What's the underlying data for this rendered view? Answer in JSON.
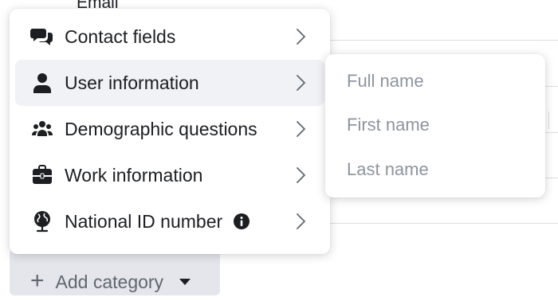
{
  "background": {
    "partial_label": "Email"
  },
  "menu": {
    "items": [
      {
        "label": "Contact fields",
        "icon": "chat-bubbles-icon"
      },
      {
        "label": "User information",
        "icon": "person-icon",
        "active": true
      },
      {
        "label": "Demographic questions",
        "icon": "group-icon"
      },
      {
        "label": "Work information",
        "icon": "briefcase-icon"
      },
      {
        "label": "National ID number",
        "icon": "globe-icon",
        "info_icon": "info-icon"
      }
    ]
  },
  "submenu": {
    "items": [
      {
        "label": "Full name"
      },
      {
        "label": "First name"
      },
      {
        "label": "Last name"
      }
    ]
  },
  "add_category": {
    "label": "Add category"
  },
  "colors": {
    "text": "#1c1e21",
    "muted_text": "#8d949e",
    "active_row": "#f0f2f5",
    "button_bg": "#e4e6eb"
  }
}
